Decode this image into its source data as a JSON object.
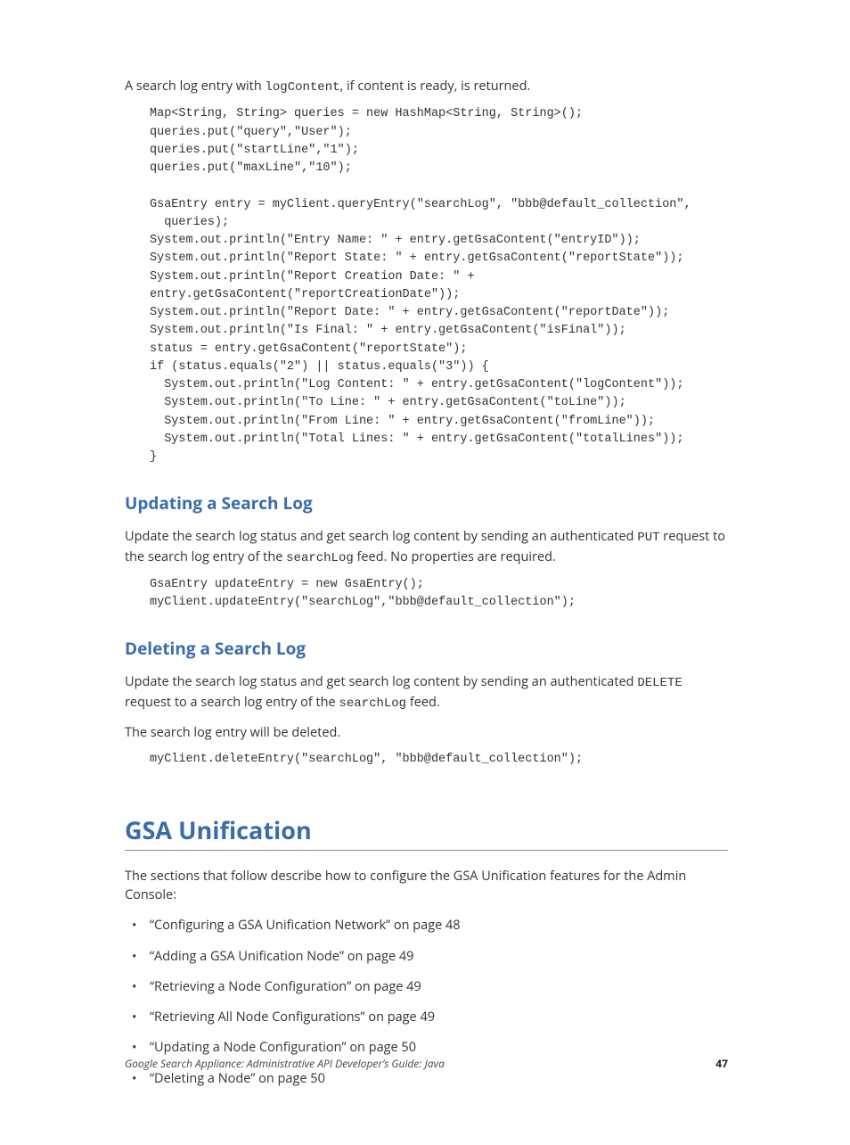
{
  "intro": {
    "prefix": "A search log entry with ",
    "code": "logContent",
    "suffix": ", if content is ready, is returned."
  },
  "code1": "Map<String, String> queries = new HashMap<String, String>();\nqueries.put(\"query\",\"User\");\nqueries.put(\"startLine\",\"1\");\nqueries.put(\"maxLine\",\"10\");\n\nGsaEntry entry = myClient.queryEntry(\"searchLog\", \"bbb@default_collection\",\n  queries);\nSystem.out.println(\"Entry Name: \" + entry.getGsaContent(\"entryID\"));\nSystem.out.println(\"Report State: \" + entry.getGsaContent(\"reportState\"));\nSystem.out.println(\"Report Creation Date: \" +\nentry.getGsaContent(\"reportCreationDate\"));\nSystem.out.println(\"Report Date: \" + entry.getGsaContent(\"reportDate\"));\nSystem.out.println(\"Is Final: \" + entry.getGsaContent(\"isFinal\"));\nstatus = entry.getGsaContent(\"reportState\");\nif (status.equals(\"2\") || status.equals(\"3\")) {\n  System.out.println(\"Log Content: \" + entry.getGsaContent(\"logContent\"));\n  System.out.println(\"To Line: \" + entry.getGsaContent(\"toLine\"));\n  System.out.println(\"From Line: \" + entry.getGsaContent(\"fromLine\"));\n  System.out.println(\"Total Lines: \" + entry.getGsaContent(\"totalLines\"));\n}",
  "section1": {
    "title": "Updating a Search Log",
    "para_pre": "Update the search log status and get search log content by sending an authenticated ",
    "para_code": "PUT",
    "para_mid": " request to the search log entry of the ",
    "para_code2": "searchLog",
    "para_suf": " feed. No properties are required.",
    "code": "GsaEntry updateEntry = new GsaEntry();\nmyClient.updateEntry(\"searchLog\",\"bbb@default_collection\");"
  },
  "section2": {
    "title": "Deleting a Search Log",
    "para_pre": "Update the search log status and get search log content by sending an authenticated ",
    "para_code": "DELETE",
    "para_mid": " request to a search log entry of the ",
    "para_code2": "searchLog",
    "para_suf": " feed.",
    "para2": "The search log entry will be deleted.",
    "code": "myClient.deleteEntry(\"searchLog\", \"bbb@default_collection\");"
  },
  "section3": {
    "title": "GSA Unification",
    "intro": "The sections that follow describe how to configure the GSA Unification features for the Admin Console:",
    "bullets": [
      "“Configuring a GSA Unification Network” on page 48",
      "“Adding a GSA Unification Node” on page 49",
      "“Retrieving a Node Configuration” on page 49",
      "“Retrieving All Node Configurations” on page 49",
      "“Updating a Node Configuration” on page 50",
      "“Deleting a Node” on page 50"
    ]
  },
  "footer": {
    "left": "Google Search Appliance: Administrative API Developer’s Guide: Java",
    "right": "47"
  }
}
